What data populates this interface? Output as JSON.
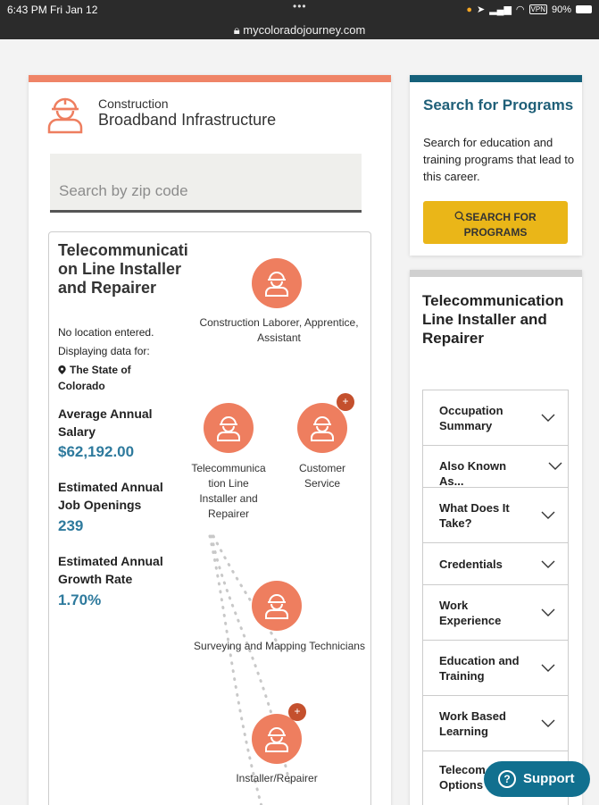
{
  "status": {
    "time": "6:43 PM  Fri Jan 12",
    "url": "mycoloradojourney.com",
    "battery": "90%",
    "vpn": "VPN"
  },
  "header": {
    "category": "Construction",
    "pathway": "Broadband Infrastructure",
    "icon": "worker-hardhat-icon"
  },
  "zip_search": {
    "placeholder": "Search by zip code"
  },
  "occupation": {
    "title": "Telecommunication Line Installer and Repairer",
    "no_location": "No location entered.",
    "displaying_for": "Displaying data for:",
    "location": "The State of Colorado",
    "stats": [
      {
        "label": "Average Annual Salary",
        "value": "$62,192.00"
      },
      {
        "label": "Estimated Annual Job Openings",
        "value": "239"
      },
      {
        "label": "Estimated Annual Growth Rate",
        "value": "1.70%"
      }
    ]
  },
  "career_map": {
    "nodes": [
      {
        "label": "Construction Laborer, Apprentice, Assistant",
        "has_plus": false
      },
      {
        "label": "Telecommunica tion Line Installer and Repairer",
        "has_plus": false
      },
      {
        "label": "Customer Service",
        "has_plus": true
      },
      {
        "label": "Surveying and Mapping Technicians",
        "has_plus": false
      },
      {
        "label": "Installer/Repairer",
        "has_plus": true
      }
    ],
    "plus_symbol": "+"
  },
  "search_programs": {
    "title": "Search for Programs",
    "description": "Search for education and training programs that lead to this career.",
    "button": "SEARCH FOR PROGRAMS"
  },
  "details": {
    "title": "Telecommunication Line Installer and Repairer",
    "sections": [
      "Occupation Summary",
      "Also Known As...",
      "What Does It Take?",
      "Credentials",
      "Work Experience",
      "Education and Training",
      "Work Based Learning",
      "Telecom Options"
    ]
  },
  "support": {
    "label": "Support",
    "icon": "question-icon",
    "glyph": "?"
  },
  "colors": {
    "accent_orange": "#ef8467",
    "teal": "#15607a",
    "value_blue": "#2e7a9d",
    "button_yellow": "#eab618"
  }
}
